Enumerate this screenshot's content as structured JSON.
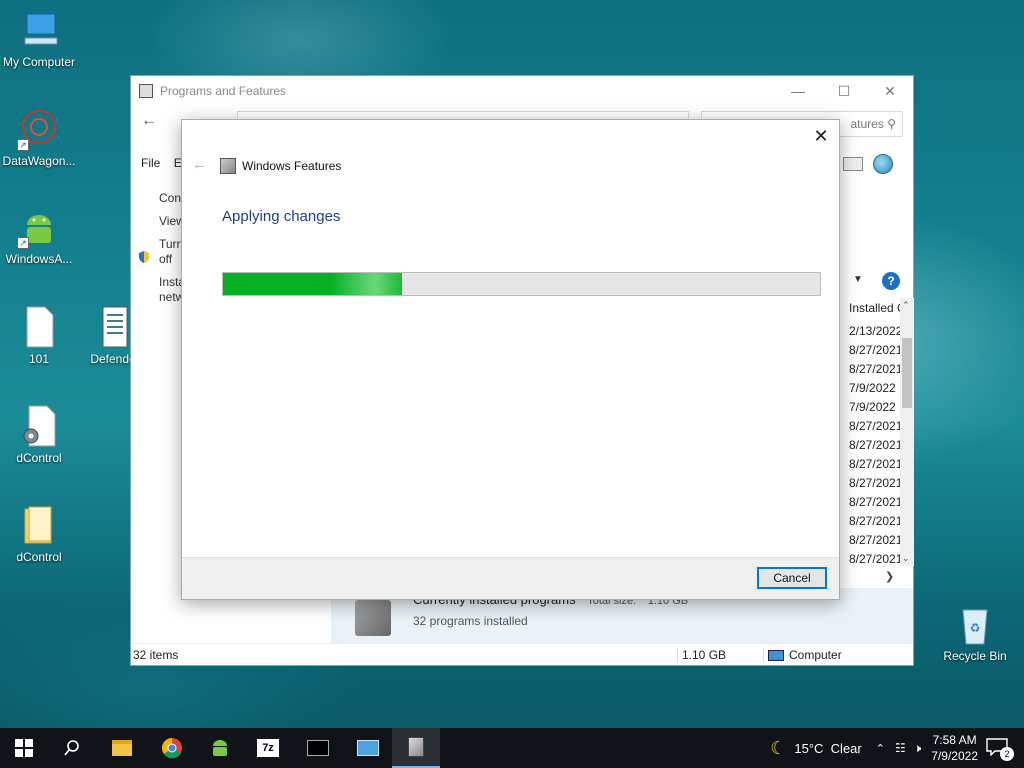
{
  "desktop": {
    "icons": [
      {
        "label": "My Computer"
      },
      {
        "label": "DataWagon..."
      },
      {
        "label": "WindowsA..."
      },
      {
        "label": "101"
      },
      {
        "label": "Defender"
      },
      {
        "label": "dControl"
      },
      {
        "label": "dControl"
      },
      {
        "label": "Recycle Bin"
      }
    ]
  },
  "explorer": {
    "title": "Programs and Features",
    "search_placeholder_visible": "atures",
    "menu": [
      "File",
      "Ed"
    ],
    "sidebar": [
      "Con",
      "View",
      "Turn\noff",
      "Insta\nnetw"
    ],
    "column_header": "Installed On",
    "dates": [
      "2/13/2022",
      "8/27/2021",
      "8/27/2021",
      "7/9/2022",
      "7/9/2022",
      "8/27/2021",
      "8/27/2021",
      "8/27/2021",
      "8/27/2021",
      "8/27/2021",
      "8/27/2021",
      "8/27/2021",
      "8/27/2021"
    ],
    "details": {
      "title": "Currently installed programs",
      "total_size_label": "Total size:",
      "total_size": "1.10 GB",
      "count": "32 programs installed"
    },
    "status": {
      "items": "32 items",
      "size": "1.10 GB",
      "location": "Computer"
    }
  },
  "dialog": {
    "title": "Windows Features",
    "heading": "Applying changes",
    "progress_fraction": 0.3,
    "cancel_label": "Cancel"
  },
  "taskbar": {
    "weather": "15°C  Clear",
    "time": "7:58 AM",
    "date": "7/9/2022",
    "notifications": "2"
  }
}
